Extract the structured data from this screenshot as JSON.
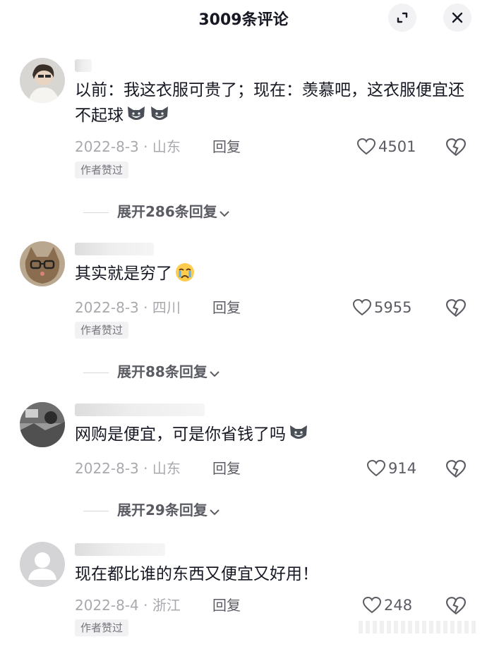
{
  "header": {
    "title": "3009条评论",
    "expand_icon": "expand-icon",
    "close_icon": "close-icon"
  },
  "comments": [
    {
      "text": "以前：我这衣服可贵了；现在：羡慕吧，这衣服便宜还不起球",
      "emoji": [
        "dog-emoji",
        "dog-emoji"
      ],
      "date_location": "2022-8-3 · 山东",
      "reply_label": "回复",
      "likes": "4501",
      "badge": "作者赞过",
      "expand_label": "展开286条回复"
    },
    {
      "text": "其实就是穷了",
      "emoji": [
        "crying-emoji"
      ],
      "date_location": "2022-8-3 · 四川",
      "reply_label": "回复",
      "likes": "5955",
      "badge": "作者赞过",
      "expand_label": "展开88条回复"
    },
    {
      "text": "网购是便宜，可是你省钱了吗",
      "emoji": [
        "dog-emoji"
      ],
      "date_location": "2022-8-3 · 山东",
      "reply_label": "回复",
      "likes": "914",
      "badge": "",
      "expand_label": "展开29条回复"
    },
    {
      "text": "现在都比谁的东西又便宜又好用！",
      "emoji": [],
      "date_location": "2022-8-4 · 浙江",
      "reply_label": "回复",
      "likes": "248",
      "badge": "作者赞过",
      "expand_label": ""
    }
  ],
  "colors": {
    "text": "#161823",
    "meta": "#a8a9ae",
    "action": "#5b5c63",
    "badge_bg": "#f2f2f4"
  }
}
